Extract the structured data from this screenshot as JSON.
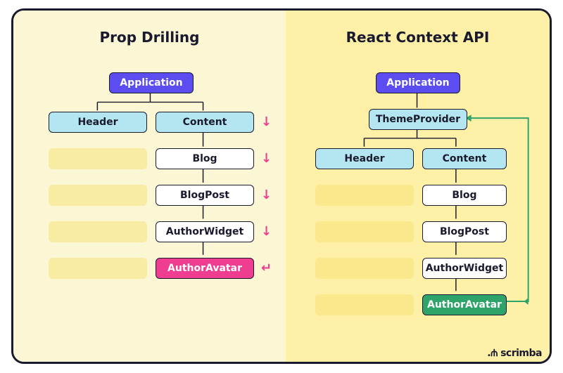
{
  "left": {
    "title": "Prop Drilling",
    "nodes": {
      "application": "Application",
      "header": "Header",
      "content": "Content",
      "blog": "Blog",
      "blogpost": "BlogPost",
      "authorwidget": "AuthorWidget",
      "authoravatar": "AuthorAvatar"
    }
  },
  "right": {
    "title": "React Context API",
    "nodes": {
      "application": "Application",
      "themeprovider": "ThemeProvider",
      "header": "Header",
      "content": "Content",
      "blog": "Blog",
      "blogpost": "BlogPost",
      "authorwidget": "AuthorWidget",
      "authoravatar": "AuthorAvatar"
    }
  },
  "brand": "scrimba",
  "colors": {
    "purple": "#5b4def",
    "cyan": "#b4e6f1",
    "pink": "#ef3e91",
    "green": "#2ea36a",
    "wire": "#1a1a2e"
  }
}
